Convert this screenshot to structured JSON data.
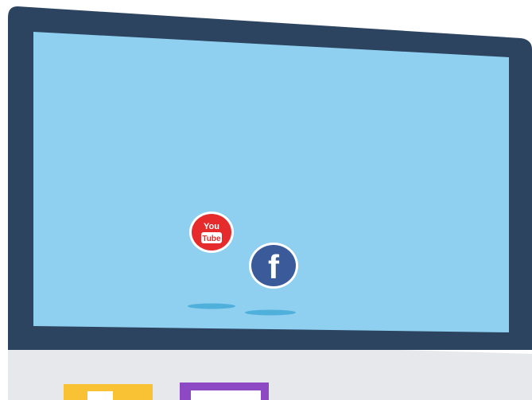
{
  "scene": {
    "colors": {
      "bezel": "#2d4461",
      "screen": "#8fd0f0",
      "screen_shadow": "#4fb0db",
      "base_panel": "#e6e8eb",
      "youtube_red": "#e52b2b",
      "facebook_blue": "#3b5a9a",
      "badge_ring": "#ffffff",
      "tile_yellow": "#f9c234",
      "tile_purple": "#8d49c3"
    },
    "icons": {
      "youtube": {
        "icon": "youtube-icon",
        "text_line1": "You",
        "text_line2": "Tube"
      },
      "facebook": {
        "icon": "facebook-icon",
        "glyph": "f"
      }
    },
    "tiles": [
      {
        "icon": "yellow-app-tile-icon",
        "color": "#f9c234"
      },
      {
        "icon": "purple-app-tile-icon",
        "color": "#8d49c3"
      }
    ]
  }
}
